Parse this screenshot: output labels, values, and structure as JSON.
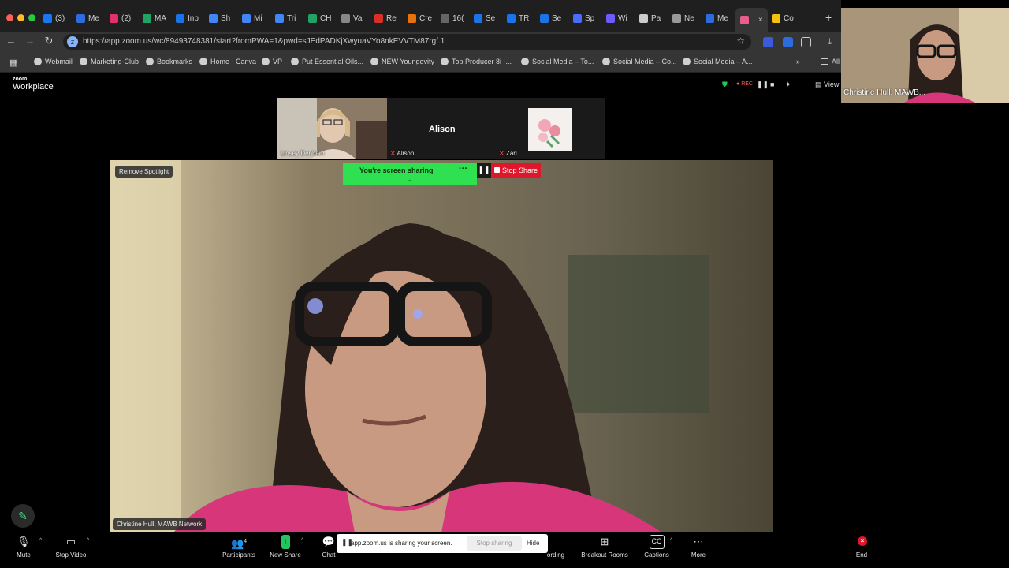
{
  "browser": {
    "tabs": [
      {
        "label": "(3)",
        "color": "#1877f2"
      },
      {
        "label": "Me",
        "color": "#2d6cdf"
      },
      {
        "label": "(2)",
        "color": "#e1306c"
      },
      {
        "label": "MA",
        "color": "#21a366"
      },
      {
        "label": "Inb",
        "color": "#1a73e8"
      },
      {
        "label": "Sh",
        "color": "#4285f4"
      },
      {
        "label": "Mi",
        "color": "#4285f4"
      },
      {
        "label": "Tri",
        "color": "#4285f4"
      },
      {
        "label": "CH",
        "color": "#21a366"
      },
      {
        "label": "Va",
        "color": "#888888"
      },
      {
        "label": "Re",
        "color": "#d93025"
      },
      {
        "label": "Cre",
        "color": "#e8710a"
      },
      {
        "label": "16(",
        "color": "#666666"
      },
      {
        "label": "Se",
        "color": "#1a73e8"
      },
      {
        "label": "TR",
        "color": "#1a73e8"
      },
      {
        "label": "Se",
        "color": "#1a73e8"
      },
      {
        "label": "Sp",
        "color": "#4b6bfb"
      },
      {
        "label": "Wi",
        "color": "#6b5bfb"
      },
      {
        "label": "Pa",
        "color": "#cccccc"
      },
      {
        "label": "Ne",
        "color": "#999999"
      },
      {
        "label": "Me",
        "color": "#2d6cdf"
      },
      {
        "label": "",
        "color": "#e85d8a"
      },
      {
        "label": "Co",
        "color": "#f4c20d"
      }
    ],
    "url": "https://app.zoom.us/wc/89493748381/start?fromPWA=1&pwd=sJEdPADKjXwyuaVYo8nkEVVTM87rgf.1",
    "bookmarks": [
      "Webmail",
      "Marketing-Club",
      "Bookmarks",
      "Home - Canva",
      "VP",
      "Put Essential Oils...",
      "NEW Youngevity",
      "Top Producer 8i -...",
      "Social Media – To...",
      "Social Media – Co...",
      "Social Media – A..."
    ],
    "all_bookmarks": "All"
  },
  "zoom": {
    "logo_top": "zoom",
    "logo_bottom": "Workplace",
    "rec_label": "REC",
    "view_label": "View",
    "participants_strip": [
      {
        "name": "Linsey Denham",
        "muted": false
      },
      {
        "name": "Alison",
        "muted": true,
        "display": "Alison"
      },
      {
        "name": "Zari",
        "muted": true
      }
    ],
    "spotlight_btn": "Remove Spotlight",
    "main_name": "Christine Hull, MAWB Network",
    "self_name": "Christine Hull, MAWB...",
    "sharing_label": "You're screen sharing",
    "stop_share": "Stop Share",
    "share_notice": "app.zoom.us is sharing your screen.",
    "stop_sharing": "Stop sharing",
    "hide": "Hide",
    "toolbar": {
      "mute": "Mute",
      "stop_video": "Stop Video",
      "participants": "Participants",
      "participants_count": "4",
      "new_share": "New Share",
      "chat": "Chat",
      "recording": "ording",
      "breakout": "Breakout Rooms",
      "captions": "Captions",
      "more": "More",
      "end": "End"
    }
  }
}
